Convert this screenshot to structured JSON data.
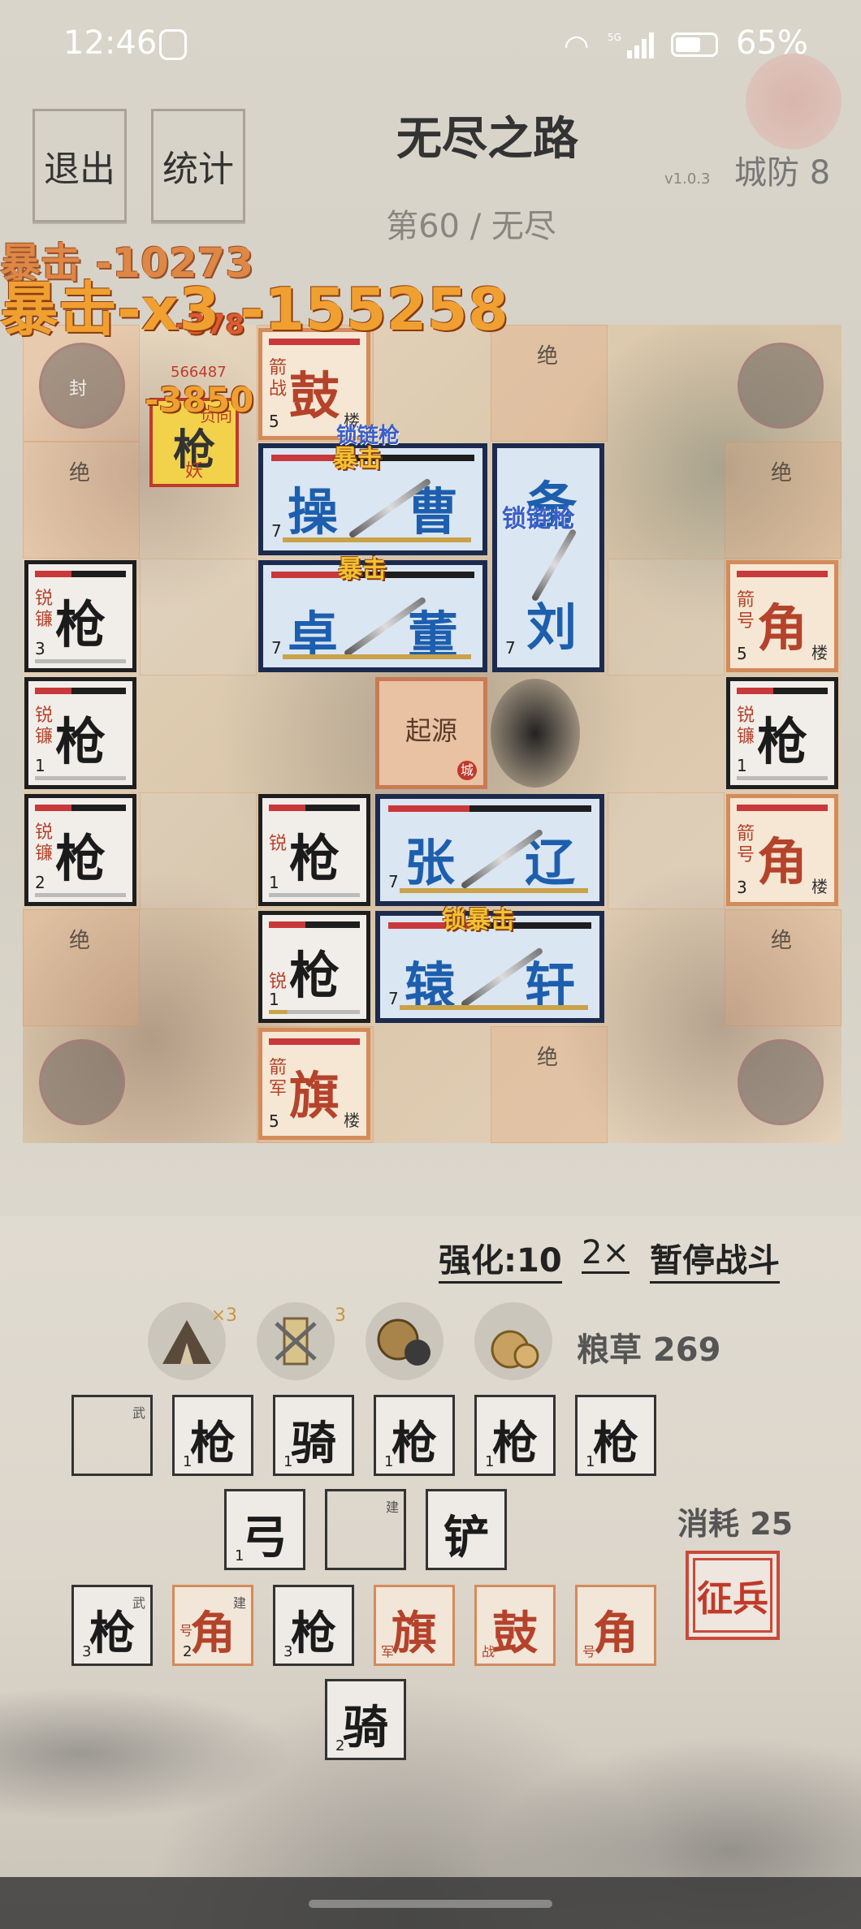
{
  "status_bar": {
    "time": "12:46",
    "network": "5G",
    "battery": "65%"
  },
  "header": {
    "exit_label": "退出",
    "stats_label": "统计",
    "title": "无尽之路",
    "version": "v1.0.3",
    "defense": "城防 8",
    "wave": "第60 / 无尽"
  },
  "board": {
    "jue": "绝",
    "corner_label": "封",
    "origin_label": "起源",
    "origin_seal": "城",
    "enemy": {
      "char": "枪",
      "tag": "负向",
      "sub": "妖",
      "hp_text": "566487"
    },
    "floats": {
      "crit1": "暴击 -10273",
      "crit2": "暴击-x3 -155258",
      "dmg1": "-3850",
      "dmg2": "-378",
      "f1": "暴击",
      "f2": "暴击",
      "f3": "锁暴击",
      "f4": "锁链枪",
      "f5": "锁链枪"
    },
    "buildings": {
      "top": {
        "char": "鼓",
        "s1": "箭",
        "s2": "战",
        "lv": "5",
        "tag": "楼"
      },
      "bottom": {
        "char": "旗",
        "s1": "箭",
        "s2": "军",
        "lv": "5",
        "tag": "楼"
      },
      "right1": {
        "char": "角",
        "s1": "箭",
        "s2": "号",
        "lv": "5",
        "tag": "楼"
      },
      "right3": {
        "char": "角",
        "s1": "箭",
        "s2": "号",
        "lv": "3",
        "tag": "楼"
      }
    },
    "spearmen": {
      "l1": {
        "char": "枪",
        "s1": "锐",
        "s2": "镰",
        "lv": "3"
      },
      "l2": {
        "char": "枪",
        "s1": "锐",
        "s2": "镰",
        "lv": "1"
      },
      "l3": {
        "char": "枪",
        "s1": "锐",
        "s2": "镰",
        "lv": "2"
      },
      "r2": {
        "char": "枪",
        "s1": "锐",
        "s2": "镰",
        "lv": "1"
      },
      "m1": {
        "char": "枪",
        "s1": "锐",
        "lv": "1"
      },
      "m2": {
        "char": "枪",
        "s1": "锐",
        "lv": "1"
      }
    },
    "heroes": {
      "cao": {
        "a": "操",
        "b": "曹",
        "lv": "7"
      },
      "dong": {
        "a": "卓",
        "b": "董",
        "lv": "7"
      },
      "liu": {
        "a": "备",
        "b": "刘",
        "lv": "7"
      },
      "zhang": {
        "a": "张",
        "b": "辽",
        "lv": "7"
      },
      "xuan": {
        "a": "辕",
        "b": "轩",
        "lv": "7"
      }
    }
  },
  "controls": {
    "enhance": "强化:10",
    "speed": "2×",
    "pause": "暂停战斗"
  },
  "resources": {
    "items": [
      {
        "name": "tent",
        "count": "×3"
      },
      {
        "name": "scroll",
        "count": "3"
      },
      {
        "name": "gong",
        "count": ""
      },
      {
        "name": "grain-bag",
        "count": ""
      }
    ],
    "grain": "粮草 269"
  },
  "inventory": {
    "row1": [
      {
        "char": "",
        "tag": "武",
        "n": "",
        "type": "empty"
      },
      {
        "char": "枪",
        "n": "1",
        "type": "normal"
      },
      {
        "char": "骑",
        "n": "1",
        "type": "normal"
      },
      {
        "char": "枪",
        "n": "1",
        "type": "normal"
      },
      {
        "char": "枪",
        "n": "1",
        "type": "normal"
      },
      {
        "char": "枪",
        "n": "1",
        "type": "normal"
      }
    ],
    "row2": [
      {
        "char": "弓",
        "n": "1",
        "type": "normal"
      },
      {
        "char": "",
        "tag": "建",
        "n": "",
        "type": "empty"
      },
      {
        "char": "铲",
        "n": "",
        "type": "normal"
      }
    ],
    "row3": [
      {
        "char": "枪",
        "n": "3",
        "tag": "武",
        "type": "normal"
      },
      {
        "char": "角",
        "n": "2",
        "s": "号",
        "tag": "建",
        "type": "orange"
      },
      {
        "char": "枪",
        "n": "3",
        "type": "normal"
      },
      {
        "char": "旗",
        "s": "军",
        "type": "orange"
      },
      {
        "char": "鼓",
        "s": "战",
        "type": "orange"
      },
      {
        "char": "角",
        "s": "号",
        "type": "orange"
      }
    ],
    "row4": [
      {
        "char": "骑",
        "n": "2",
        "type": "normal"
      }
    ]
  },
  "recruit": {
    "cost": "消耗 25",
    "label": "征兵"
  }
}
